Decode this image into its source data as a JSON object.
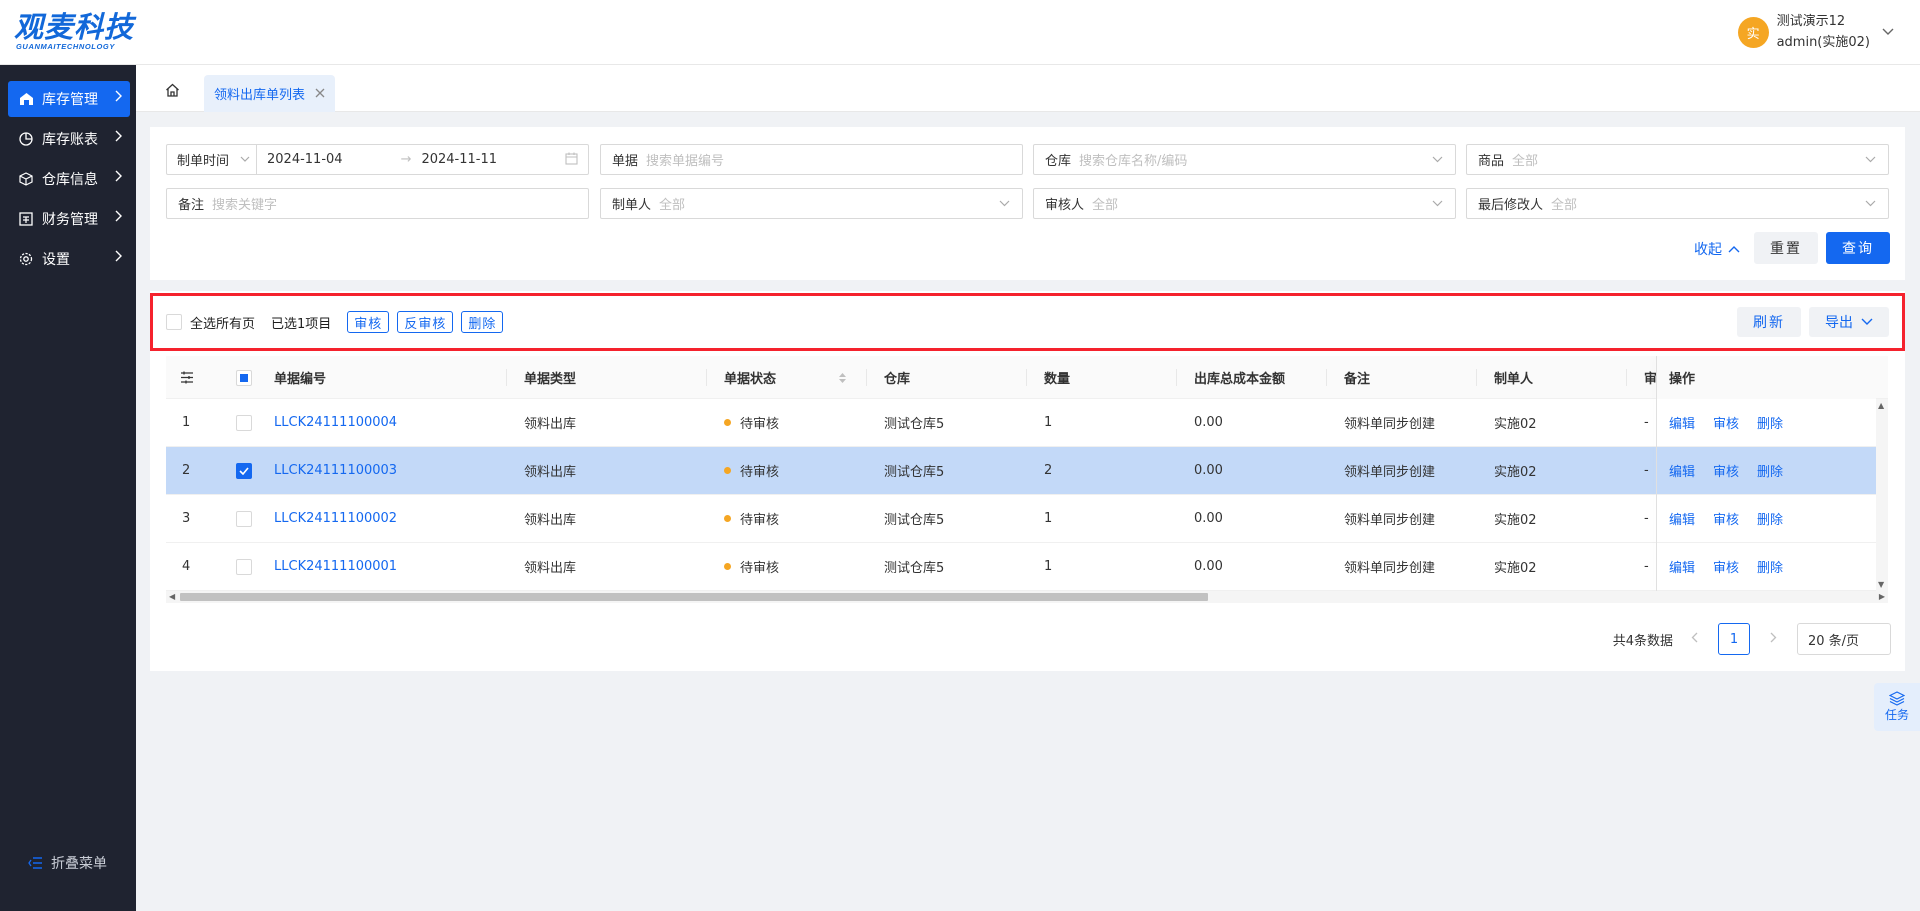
{
  "header": {
    "logo_text": "观麦科技",
    "logo_sub": "GUANMAITECHNOLOGY",
    "avatar_char": "实",
    "user_name": "测试演示12",
    "user_role": "admin(实施02)"
  },
  "sidebar": {
    "items": [
      {
        "label": "库存管理",
        "icon": "warehouse-icon"
      },
      {
        "label": "库存账表",
        "icon": "pie-chart-icon"
      },
      {
        "label": "仓库信息",
        "icon": "cube-icon"
      },
      {
        "label": "财务管理",
        "icon": "finance-icon"
      },
      {
        "label": "设置",
        "icon": "gear-icon"
      }
    ],
    "collapse_label": "折叠菜单"
  },
  "tabs": {
    "active_label": "领料出库单列表"
  },
  "filters": {
    "date_type": "制单时间",
    "date_start": "2024-11-04",
    "date_end": "2024-11-11",
    "doc_label": "单据",
    "doc_placeholder": "搜索单据编号",
    "warehouse_label": "仓库",
    "warehouse_placeholder": "搜索仓库名称/编码",
    "product_label": "商品",
    "product_value": "全部",
    "remark_label": "备注",
    "remark_placeholder": "搜索关键字",
    "creator_label": "制单人",
    "creator_value": "全部",
    "auditor_label": "审核人",
    "auditor_value": "全部",
    "modifier_label": "最后修改人",
    "modifier_value": "全部",
    "collapse_label": "收起",
    "reset_label": "重置",
    "query_label": "查询"
  },
  "toolbar": {
    "select_all_label": "全选所有页",
    "selected_text": "已选1项目",
    "audit_label": "审核",
    "unaudit_label": "反审核",
    "delete_label": "删除",
    "refresh_label": "刷新",
    "export_label": "导出"
  },
  "table": {
    "headers": {
      "doc_no": "单据编号",
      "doc_type": "单据类型",
      "doc_status": "单据状态",
      "warehouse": "仓库",
      "qty": "数量",
      "cost": "出库总成本金额",
      "remark": "备注",
      "creator": "制单人",
      "auditor": "审",
      "ops": "操作"
    },
    "rows": [
      {
        "idx": "1",
        "doc_no": "LLCK24111100004",
        "doc_type": "领料出库",
        "status": "待审核",
        "warehouse": "测试仓库5",
        "qty": "1",
        "cost": "0.00",
        "remark": "领料单同步创建",
        "creator": "实施02",
        "auditor": "-",
        "selected": false
      },
      {
        "idx": "2",
        "doc_no": "LLCK24111100003",
        "doc_type": "领料出库",
        "status": "待审核",
        "warehouse": "测试仓库5",
        "qty": "2",
        "cost": "0.00",
        "remark": "领料单同步创建",
        "creator": "实施02",
        "auditor": "-",
        "selected": true
      },
      {
        "idx": "3",
        "doc_no": "LLCK24111100002",
        "doc_type": "领料出库",
        "status": "待审核",
        "warehouse": "测试仓库5",
        "qty": "1",
        "cost": "0.00",
        "remark": "领料单同步创建",
        "creator": "实施02",
        "auditor": "-",
        "selected": false
      },
      {
        "idx": "4",
        "doc_no": "LLCK24111100001",
        "doc_type": "领料出库",
        "status": "待审核",
        "warehouse": "测试仓库5",
        "qty": "1",
        "cost": "0.00",
        "remark": "领料单同步创建",
        "creator": "实施02",
        "auditor": "-",
        "selected": false
      }
    ],
    "op_edit": "编辑",
    "op_audit": "审核",
    "op_delete": "删除"
  },
  "pagination": {
    "total_text": "共4条数据",
    "current_page": "1",
    "page_size": "20 条/页"
  },
  "task_float": {
    "label": "任务"
  },
  "colors": {
    "primary": "#1468f0",
    "sidebar_bg": "#1f2330",
    "status_pending": "#f5a623",
    "selected_row": "#c3d9f8",
    "highlight": "#f5222d"
  }
}
